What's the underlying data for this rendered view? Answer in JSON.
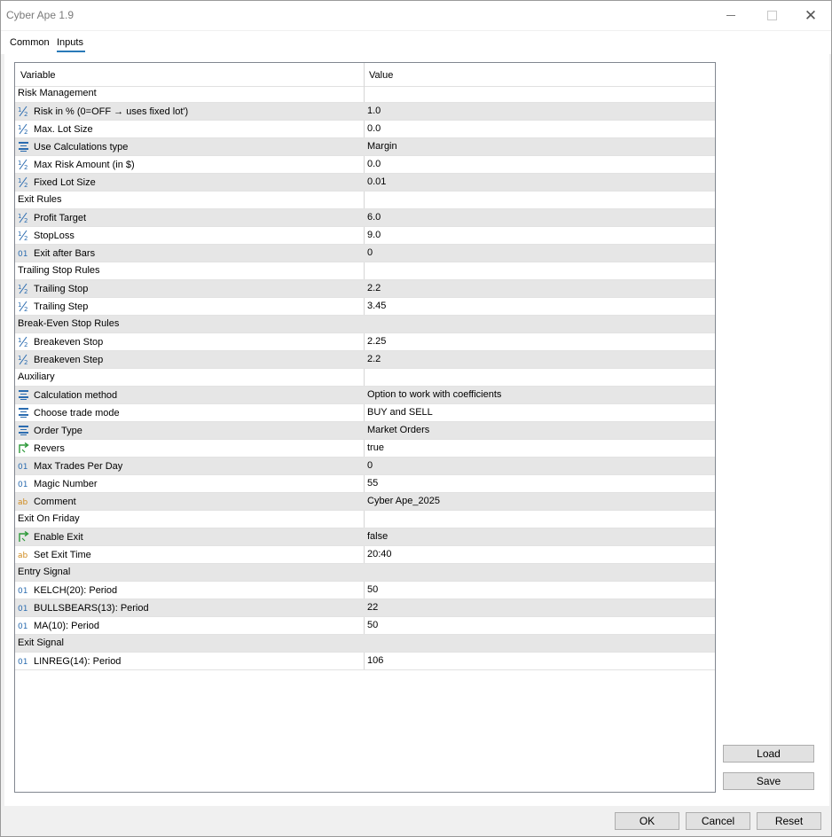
{
  "window": {
    "title": "Cyber Ape 1.9"
  },
  "tabs": [
    {
      "label": "Common"
    },
    {
      "label": "Inputs"
    }
  ],
  "grid": {
    "headers": {
      "variable": "Variable",
      "value": "Value"
    },
    "rows": [
      {
        "icon": "",
        "variable": "Risk Management",
        "value": ""
      },
      {
        "icon": "fraction-icon",
        "variable": "Risk in % (0=OFF → uses fixed lot')",
        "value": "1.0"
      },
      {
        "icon": "fraction-icon",
        "variable": "Max. Lot Size",
        "value": "0.0"
      },
      {
        "icon": "enum-icon",
        "variable": "Use Calculations type",
        "value": "Margin"
      },
      {
        "icon": "fraction-icon",
        "variable": "Max Risk Amount (in $)",
        "value": "0.0"
      },
      {
        "icon": "fraction-icon",
        "variable": "Fixed Lot Size",
        "value": "0.01"
      },
      {
        "icon": "",
        "variable": "Exit Rules",
        "value": ""
      },
      {
        "icon": "fraction-icon",
        "variable": "Profit Target",
        "value": "6.0"
      },
      {
        "icon": "fraction-icon",
        "variable": "StopLoss",
        "value": "9.0"
      },
      {
        "icon": "integer-icon",
        "variable": "Exit after Bars",
        "value": "0"
      },
      {
        "icon": "",
        "variable": "Trailing Stop Rules",
        "value": ""
      },
      {
        "icon": "fraction-icon",
        "variable": "Trailing Stop",
        "value": "2.2"
      },
      {
        "icon": "fraction-icon",
        "variable": "Trailing Step",
        "value": "3.45"
      },
      {
        "icon": "",
        "variable": "Break-Even Stop Rules",
        "value": ""
      },
      {
        "icon": "fraction-icon",
        "variable": "Breakeven Stop",
        "value": "2.25"
      },
      {
        "icon": "fraction-icon",
        "variable": "Breakeven Step",
        "value": "2.2"
      },
      {
        "icon": "",
        "variable": "Auxiliary",
        "value": ""
      },
      {
        "icon": "enum-icon",
        "variable": "Calculation method",
        "value": "Option to work with coefficients"
      },
      {
        "icon": "enum-icon",
        "variable": "Choose trade mode",
        "value": "BUY and SELL"
      },
      {
        "icon": "enum-icon",
        "variable": "Order Type",
        "value": "Market Orders"
      },
      {
        "icon": "bool-icon",
        "variable": "Revers",
        "value": "true"
      },
      {
        "icon": "integer-icon",
        "variable": "Max Trades Per Day",
        "value": "0"
      },
      {
        "icon": "integer-icon",
        "variable": "Magic Number",
        "value": "55"
      },
      {
        "icon": "string-icon",
        "variable": "Comment",
        "value": "Cyber Ape_2025"
      },
      {
        "icon": "",
        "variable": "Exit On Friday",
        "value": ""
      },
      {
        "icon": "bool-icon",
        "variable": "Enable Exit",
        "value": "false"
      },
      {
        "icon": "string-icon",
        "variable": "Set Exit Time",
        "value": "20:40"
      },
      {
        "icon": "",
        "variable": "Entry Signal",
        "value": ""
      },
      {
        "icon": "integer-icon",
        "variable": "KELCH(20): Period",
        "value": "50"
      },
      {
        "icon": "integer-icon",
        "variable": "BULLSBEARS(13): Period",
        "value": "22"
      },
      {
        "icon": "integer-icon",
        "variable": "MA(10): Period",
        "value": "50"
      },
      {
        "icon": "",
        "variable": "Exit Signal",
        "value": ""
      },
      {
        "icon": "integer-icon",
        "variable": "LINREG(14): Period",
        "value": "106"
      }
    ]
  },
  "side_buttons": {
    "load": "Load",
    "save": "Save"
  },
  "footer_buttons": {
    "ok": "OK",
    "cancel": "Cancel",
    "reset": "Reset"
  },
  "colors": {
    "accent": "#2a7ab8",
    "icon_blue": "#2b6cb0",
    "icon_green": "#2e9a3a",
    "icon_orange": "#d08a1c"
  }
}
